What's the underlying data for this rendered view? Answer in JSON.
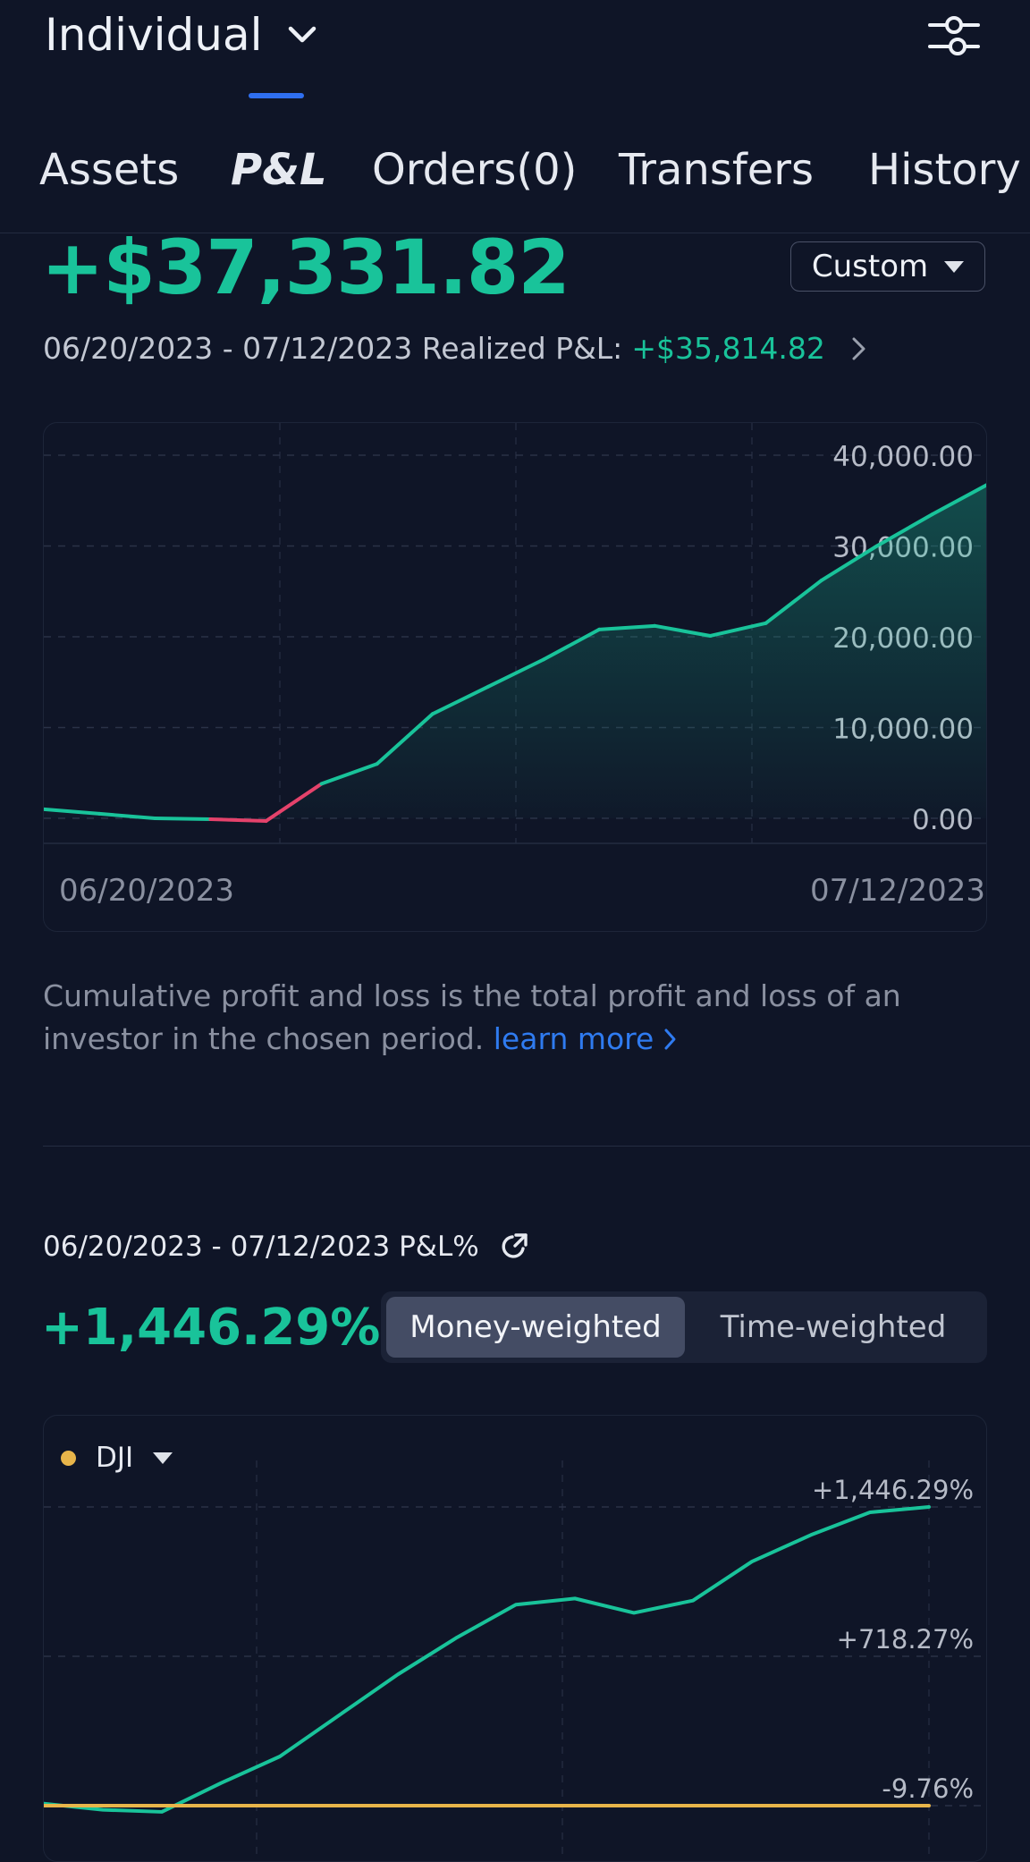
{
  "header": {
    "account": "Individual"
  },
  "tabs": [
    {
      "label": "Assets"
    },
    {
      "label": "P&L"
    },
    {
      "label": "Orders(0)"
    },
    {
      "label": "Transfers"
    },
    {
      "label": "History"
    }
  ],
  "summary": {
    "total_pl": "+$37,331.82",
    "period_select": "Custom",
    "range": "06/20/2023 - 07/12/2023",
    "realized_label": "Realized P&L:",
    "realized_value": "+$35,814.82"
  },
  "colors": {
    "positive": "#19c39a",
    "negative": "#e5426b",
    "link": "#2f7bf0",
    "benchmark": "#e8b54a"
  },
  "chart_data": [
    {
      "type": "area",
      "x_start_label": "06/20/2023",
      "x_end_label": "07/12/2023",
      "y_ticks": [
        "40,000.00",
        "30,000.00",
        "20,000.00",
        "10,000.00",
        "0.00"
      ],
      "ylim": [
        -4500,
        40000
      ],
      "grid": true,
      "series": [
        {
          "values": [
            1000,
            500,
            0,
            -100,
            -300,
            3800,
            6000,
            11500,
            14500,
            17500,
            20800,
            21200,
            20100,
            21500,
            26200,
            30000,
            33500,
            36800
          ]
        }
      ]
    },
    {
      "type": "line",
      "y_ticks": [
        "+1,446.29%",
        "+718.27%",
        "-9.76%"
      ],
      "ylim": [
        -9.76,
        1446.29
      ],
      "grid": true,
      "series": [
        {
          "values": [
            0,
            -30,
            -40,
            100,
            230,
            430,
            630,
            810,
            970,
            1000,
            930,
            990,
            1180,
            1310,
            1420,
            1446.29
          ]
        },
        {
          "name": "DJI",
          "values": [
            -9.76,
            -9.76,
            -9.76,
            -9.76,
            -9.76,
            -9.76,
            -9.76,
            -9.76,
            -9.76,
            -9.76,
            -9.76,
            -9.76,
            -9.76,
            -9.76,
            -9.76,
            -9.76
          ]
        }
      ]
    }
  ],
  "description": {
    "text": "Cumulative profit and loss is the total profit and loss of an investor in the chosen period. ",
    "link": "learn more"
  },
  "pct_section": {
    "header": "06/20/2023 - 07/12/2023 P&L%",
    "value": "+1,446.29%",
    "toggle": [
      "Money-weighted",
      "Time-weighted"
    ],
    "benchmark": "DJI"
  }
}
